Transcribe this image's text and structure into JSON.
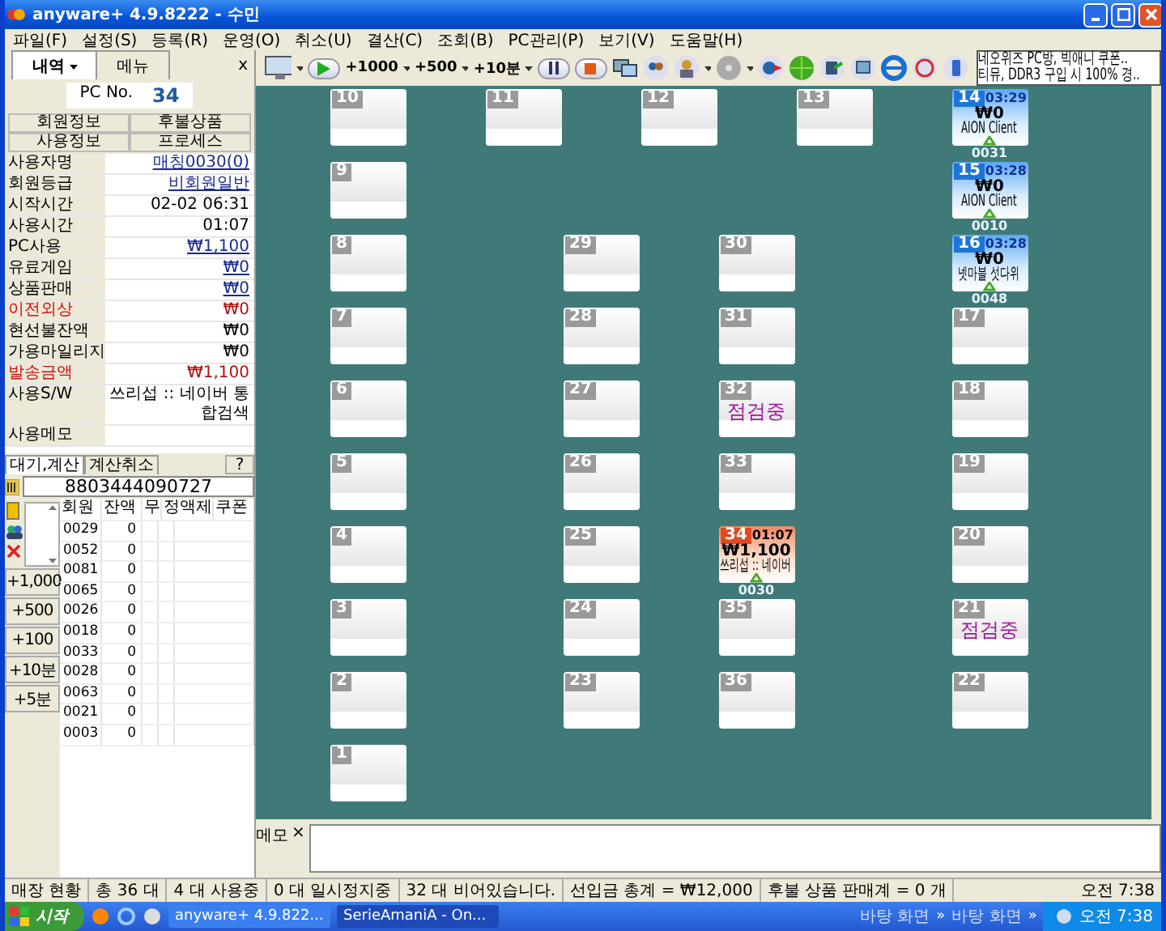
{
  "window": {
    "title": "anyware+  4.9.8222 - 수민"
  },
  "menu": [
    "파일(F)",
    "설정(S)",
    "등록(R)",
    "운영(O)",
    "취소(U)",
    "결산(C)",
    "조회(B)",
    "PC관리(P)",
    "보기(V)",
    "도움말(H)"
  ],
  "side_tabs": [
    {
      "label": "내역",
      "has_menu": true,
      "selected": true
    },
    {
      "label": "메뉴",
      "has_menu": false,
      "selected": false
    }
  ],
  "side_close": "x",
  "toolbar": {
    "steps": [
      "+1000",
      "+500",
      "+10분"
    ],
    "news": [
      "네오위즈 PC방, 빅애니 쿠폰..",
      "티뮤, DDR3 구입 시 100% 경.."
    ]
  },
  "pc_no": {
    "label": "PC No.",
    "value": "34"
  },
  "info_buttons": [
    "회원정보",
    "후불상품",
    "사용정보",
    "프로세스"
  ],
  "info_rows": [
    {
      "label": "사용자명",
      "value": "매칭0030(0)",
      "alert": false,
      "link": true
    },
    {
      "label": "회원등급",
      "value": "비회원일반",
      "alert": false,
      "link": true
    },
    {
      "label": "시작시간",
      "value": "02-02 06:31",
      "alert": false,
      "link": false
    },
    {
      "label": "사용시간",
      "value": "01:07",
      "alert": false,
      "link": false
    },
    {
      "label": "PC사용",
      "value": "₩1,100",
      "alert": false,
      "link": true
    },
    {
      "label": "유료게임",
      "value": "₩0",
      "alert": false,
      "link": true
    },
    {
      "label": "상품판매",
      "value": "₩0",
      "alert": false,
      "link": true
    },
    {
      "label": "이전외상",
      "value": "₩0",
      "alert": true,
      "link": false
    },
    {
      "label": "현선불잔액",
      "value": "₩0",
      "alert": false,
      "link": false
    },
    {
      "label": "가용마일리지",
      "value": "₩0",
      "alert": false,
      "link": false
    },
    {
      "label": "발송금액",
      "value": "₩1,100",
      "alert": true,
      "link": false
    },
    {
      "label": "사용S/W",
      "value": "쓰리섭 :: 네이버 통합검색",
      "alert": false,
      "link": false
    },
    {
      "label": "사용메모",
      "alert": false
    }
  ],
  "calc_tabs": [
    {
      "label": "대기,계산",
      "selected": true
    },
    {
      "label": "계산취소",
      "selected": false
    }
  ],
  "help": "?",
  "barcode": "8803444090727",
  "quick_buttons": [
    "+1,000",
    "+500",
    "+100",
    "+10분",
    "+5분"
  ],
  "members": {
    "columns": [
      "회원",
      "잔액",
      "무",
      "정액제",
      "쿠폰"
    ],
    "rows": [
      [
        "0029",
        "0"
      ],
      [
        "0052",
        "0"
      ],
      [
        "0081",
        "0"
      ],
      [
        "0065",
        "0"
      ],
      [
        "0026",
        "0"
      ],
      [
        "0018",
        "0"
      ],
      [
        "0033",
        "0"
      ],
      [
        "0028",
        "0"
      ],
      [
        "0063",
        "0"
      ],
      [
        "0021",
        "0"
      ],
      [
        "0003",
        "0"
      ]
    ]
  },
  "seats": [
    {
      "number": "10",
      "kind": "idle"
    },
    {
      "number": "11",
      "kind": "idle"
    },
    {
      "number": "12",
      "kind": "idle"
    },
    {
      "number": "13",
      "kind": "idle"
    },
    {
      "number": "14",
      "kind": "member",
      "time": "03:29",
      "amount": "₩0",
      "program": "AION Client",
      "user": "0031"
    },
    {
      "number": "9",
      "kind": "idle"
    },
    {
      "number": "15",
      "kind": "member",
      "time": "03:28",
      "amount": "₩0",
      "program": "AION Client",
      "user": "0010"
    },
    {
      "number": "8",
      "kind": "idle"
    },
    {
      "number": "29",
      "kind": "idle"
    },
    {
      "number": "30",
      "kind": "idle"
    },
    {
      "number": "16",
      "kind": "member",
      "time": "03:28",
      "amount": "₩0",
      "program": "넷마블 섯다위",
      "user": "0048"
    },
    {
      "number": "7",
      "kind": "idle"
    },
    {
      "number": "28",
      "kind": "idle"
    },
    {
      "number": "31",
      "kind": "idle"
    },
    {
      "number": "17",
      "kind": "idle"
    },
    {
      "number": "6",
      "kind": "idle"
    },
    {
      "number": "27",
      "kind": "idle"
    },
    {
      "number": "32",
      "kind": "inspection",
      "note": "점검중"
    },
    {
      "number": "18",
      "kind": "idle"
    },
    {
      "number": "5",
      "kind": "idle"
    },
    {
      "number": "26",
      "kind": "idle"
    },
    {
      "number": "33",
      "kind": "idle"
    },
    {
      "number": "19",
      "kind": "idle"
    },
    {
      "number": "4",
      "kind": "idle"
    },
    {
      "number": "25",
      "kind": "idle"
    },
    {
      "number": "34",
      "kind": "guest",
      "time": "01:07",
      "amount": "₩1,100",
      "program": "쓰리섭 :: 네이버",
      "user": "0030"
    },
    {
      "number": "20",
      "kind": "idle"
    },
    {
      "number": "3",
      "kind": "idle"
    },
    {
      "number": "24",
      "kind": "idle"
    },
    {
      "number": "35",
      "kind": "idle"
    },
    {
      "number": "21",
      "kind": "inspection",
      "note": "점검중"
    },
    {
      "number": "2",
      "kind": "idle"
    },
    {
      "number": "23",
      "kind": "idle"
    },
    {
      "number": "36",
      "kind": "idle"
    },
    {
      "number": "22",
      "kind": "idle"
    },
    {
      "number": "1",
      "kind": "idle"
    }
  ],
  "memo": {
    "label": "메모",
    "close": "×"
  },
  "status_bar": [
    "매장 현황",
    "총 36 대",
    "4 대 사용중",
    "0 대 일시정지중",
    "32 대 비어있습니다.",
    "선입금 총계 = ₩12,000",
    "후불 상품 판매계 = 0 개",
    "오전 7:38"
  ],
  "taskbar": {
    "start": "시작",
    "windows": [
      {
        "label": "anyware+  4.9.822...",
        "selected": false
      },
      {
        "label": "SerieAmaniA - On...",
        "selected": true
      }
    ],
    "toolbars": [
      "바탕 화면",
      "바탕 화면"
    ],
    "more": "»",
    "clock": "오전 7:38"
  }
}
